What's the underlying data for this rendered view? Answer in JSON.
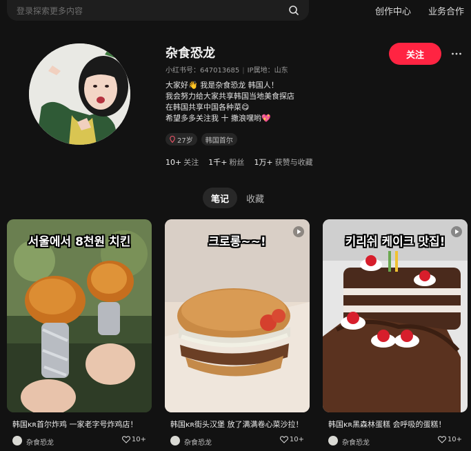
{
  "header": {
    "search_placeholder": "登录探索更多内容",
    "nav_creator": "创作中心",
    "nav_business": "业务合作"
  },
  "profile": {
    "name": "杂食恐龙",
    "id_label": "小红书号：647013685",
    "ip_label": "IP属地：山东",
    "bio": [
      "大家好👋 我是杂食恐龙 韩国人！",
      "我会努力给大家共享韩国当地美食探店",
      "在韩国共享中国各种菜😋",
      "希望多多关注我 十 撒浪嘿哟💖"
    ],
    "tags": [
      "27岁",
      "韩国首尔"
    ],
    "stats": [
      {
        "num": "10+",
        "label": "关注"
      },
      {
        "num": "1千+",
        "label": "粉丝"
      },
      {
        "num": "1万+",
        "label": "获赞与收藏"
      }
    ],
    "follow_label": "关注"
  },
  "tabs": {
    "notes": "笔记",
    "collect": "收藏"
  },
  "cards": [
    {
      "caption": "서울에서 8천원 치킨",
      "title": "韩国ᴋʀ首尔炸鸡 一家老字号炸鸡店！",
      "author": "杂食恐龙",
      "likes": "10+"
    },
    {
      "caption": "크로롱~~!",
      "title": "韩国ᴋʀ街头汉堡 放了满满卷心菜沙拉！",
      "author": "杂食恐龙",
      "likes": "10+"
    },
    {
      "caption": "키리쉬 케이크 맛집!",
      "title": "韩国ᴋʀ黑森林蛋糕 会呼吸的蛋糕！",
      "author": "杂食恐龙",
      "likes": "10+"
    }
  ],
  "colors": {
    "accent": "#ff2442",
    "background": "#121212"
  }
}
